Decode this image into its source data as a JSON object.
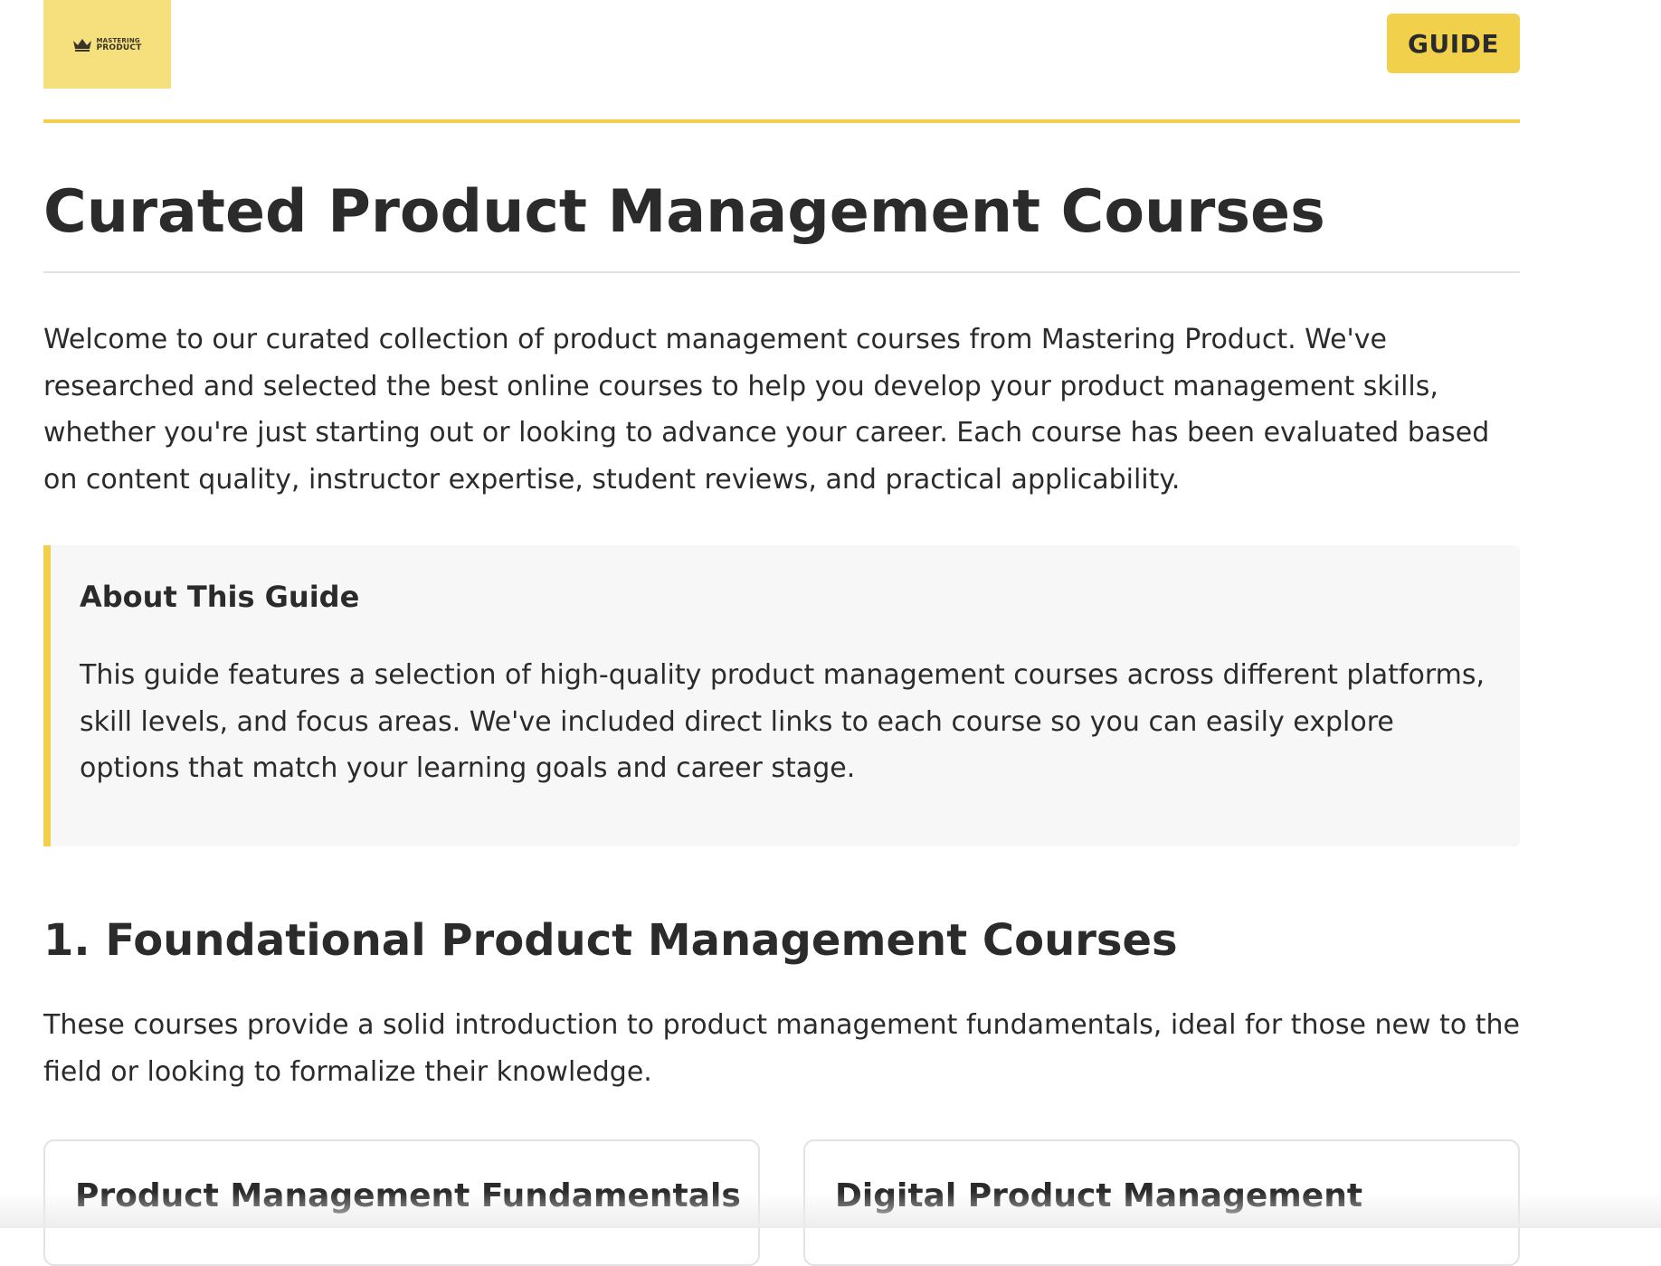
{
  "header": {
    "logo": {
      "line1": "MASTERING",
      "line2": "PRODUCT",
      "icon": "crown-icon"
    },
    "guide_label": "GUIDE"
  },
  "main": {
    "title": "Curated Product Management Courses",
    "intro": "Welcome to our curated collection of product management courses from Mastering Product. We've researched and selected the best online courses to help you develop your product management skills, whether you're just starting out or looking to advance your career. Each course has been evaluated based on content quality, instructor expertise, student reviews, and practical applicability.",
    "about": {
      "title": "About This Guide",
      "text": "This guide features a selection of high-quality product management courses across different platforms, skill levels, and focus areas. We've included direct links to each course so you can easily explore options that match your learning goals and career stage."
    },
    "sections": [
      {
        "title": "1. Foundational Product Management Courses",
        "description": "These courses provide a solid introduction to product management fundamentals, ideal for those new to the field or looking to formalize their knowledge.",
        "cards": [
          {
            "title": "Product Management Fundamentals"
          },
          {
            "title": "Digital Product Management"
          }
        ]
      }
    ]
  },
  "colors": {
    "accent": "#f1d04b",
    "logo_bg": "#f5e07d",
    "text": "#2b2b2b",
    "panel_bg": "#f7f7f7",
    "rule": "#e3e3e3"
  }
}
